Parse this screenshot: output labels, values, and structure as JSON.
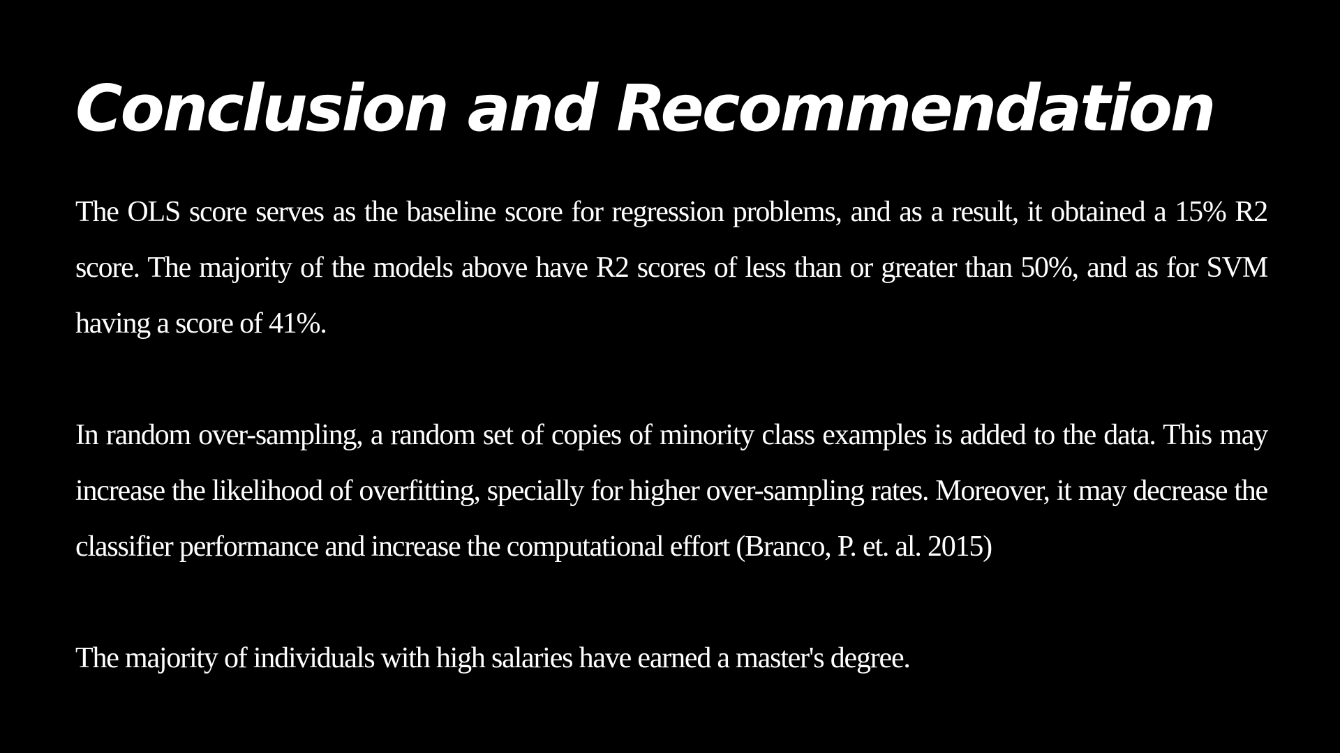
{
  "slide": {
    "title": "Conclusion and Recommendation",
    "paragraphs": [
      "The OLS score serves as the baseline score for regression problems, and as a result, it obtained a 15% R2 score. The majority of the models above have R2 scores of less than or greater than 50%, and as for SVM having a score of 41%.",
      "In random over-sampling, a random set of copies of minority class examples is added to the data. This may increase the likelihood of overfitting, specially for higher over-sampling rates. Moreover, it may decrease the classifier performance and increase the computational effort (Branco, P. et. al. 2015)",
      "The majority of individuals with high salaries have earned a master's degree."
    ]
  },
  "colors": {
    "background": "#000000",
    "text": "#ffffff"
  }
}
